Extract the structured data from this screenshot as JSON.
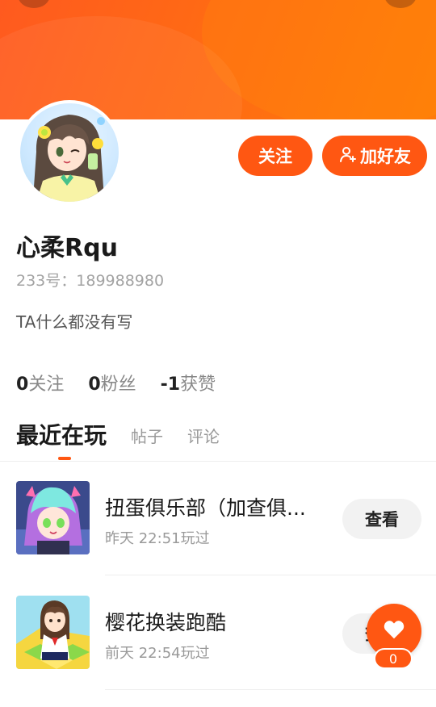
{
  "profile": {
    "name": "心柔Rqu",
    "uid": "233号：189988980",
    "bio": "TA什么都没有写",
    "follow_label": "关注",
    "add_friend_label": "加好友"
  },
  "stats": [
    {
      "num": "0",
      "label": "关注"
    },
    {
      "num": "0",
      "label": "粉丝"
    },
    {
      "num": "-1",
      "label": "获赞"
    }
  ],
  "tabs": {
    "active": "最近在玩",
    "posts": "帖子",
    "comments": "评论"
  },
  "games": [
    {
      "title": "扭蛋俱乐部（加查俱...",
      "time": "昨天 22:51玩过",
      "button": "查看"
    },
    {
      "title": "樱花换装跑酷",
      "time": "前天 22:54玩过",
      "button": "查看"
    }
  ],
  "like": {
    "count": "0"
  },
  "colors": {
    "accent": "#ff5712",
    "header": "#ff6a14"
  },
  "icons": {
    "add_friend": "person-add-icon",
    "like": "heart-icon"
  }
}
